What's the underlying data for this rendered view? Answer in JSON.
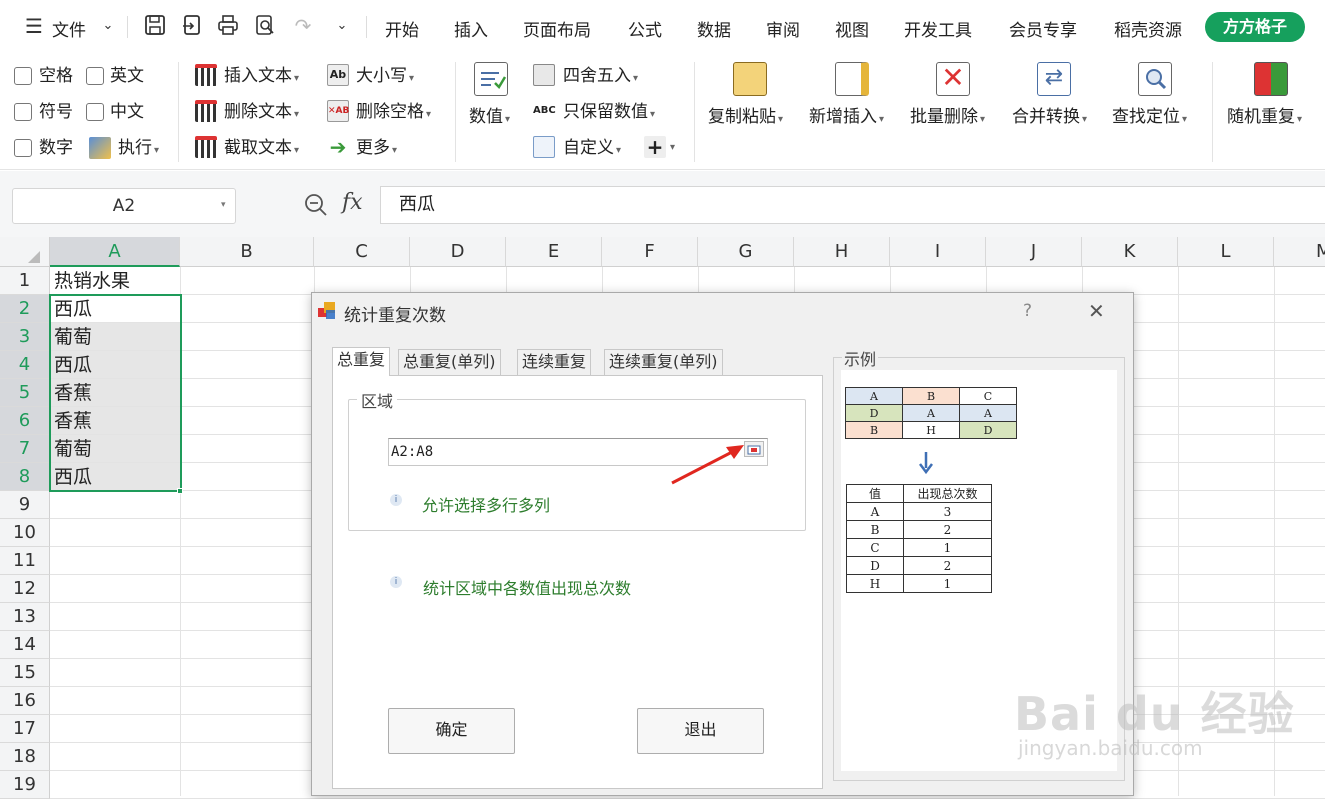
{
  "menubar": {
    "file_label": "文件",
    "tabs": [
      "开始",
      "插入",
      "页面布局",
      "公式",
      "数据",
      "审阅",
      "视图",
      "开发工具",
      "会员专享",
      "稻壳资源"
    ],
    "vip_label": "方方格子"
  },
  "ribbon": {
    "checkboxes": [
      "空格",
      "英文",
      "符号",
      "中文",
      "数字"
    ],
    "execute_label": "执行",
    "text_tools": [
      "插入文本",
      "删除文本",
      "截取文本"
    ],
    "case_tools": [
      "大小写",
      "删除空格",
      "更多"
    ],
    "number_label": "数值",
    "number_tools": [
      "四舍五入",
      "只保留数值",
      "自定义"
    ],
    "big_buttons": [
      "复制粘贴",
      "新增插入",
      "批量删除",
      "合并转换",
      "查找定位",
      "随机重复"
    ]
  },
  "formula_bar": {
    "name_box": "A2",
    "fx_label": "fx",
    "value": "西瓜"
  },
  "grid": {
    "columns": [
      "A",
      "B",
      "C",
      "D",
      "E",
      "F",
      "G",
      "H",
      "I",
      "J",
      "K",
      "L",
      "M"
    ],
    "rows": [
      "1",
      "2",
      "3",
      "4",
      "5",
      "6",
      "7",
      "8",
      "9",
      "10",
      "11",
      "12",
      "13",
      "14",
      "15",
      "16",
      "17",
      "18",
      "19"
    ],
    "col_a_values": [
      "热销水果",
      "西瓜",
      "葡萄",
      "西瓜",
      "香蕉",
      "香蕉",
      "葡萄",
      "西瓜"
    ]
  },
  "dialog": {
    "title": "统计重复次数",
    "help_label": "?",
    "tabs": [
      "总重复",
      "总重复(单列)",
      "连续重复",
      "连续重复(单列)"
    ],
    "region_label": "区域",
    "range_value": "A2:A8",
    "note1": "允许选择多行多列",
    "note2": "统计区域中各数值出现总次数",
    "ok_label": "确定",
    "exit_label": "退出",
    "example_label": "示例",
    "example_input": [
      [
        "A",
        "B",
        "C"
      ],
      [
        "D",
        "A",
        "A"
      ],
      [
        "B",
        "H",
        "D"
      ]
    ],
    "example_headers": [
      "值",
      "出现总次数"
    ],
    "example_output": [
      [
        "A",
        "3"
      ],
      [
        "B",
        "2"
      ],
      [
        "C",
        "1"
      ],
      [
        "D",
        "2"
      ],
      [
        "H",
        "1"
      ]
    ],
    "colors": {
      "blue": "#dce6f2",
      "peach": "#fbe0d0",
      "green": "#d7e4bd"
    }
  },
  "watermark": {
    "brand": "Bai du 经验",
    "url": "jingyan.baidu.com"
  },
  "colors": {
    "accent_green": "#16a05d",
    "selection_border": "#1e9b5a",
    "row_header_green": "#1e9b5a"
  }
}
